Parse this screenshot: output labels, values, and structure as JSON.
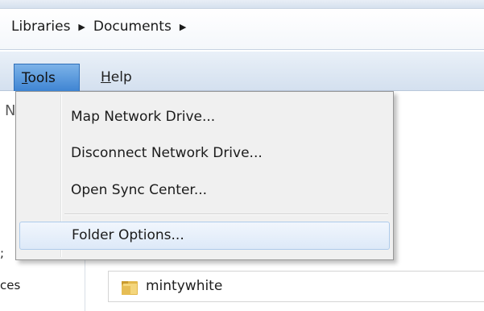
{
  "address": {
    "crumbs": [
      "Libraries",
      "Documents"
    ],
    "separator": "▶"
  },
  "menubar": {
    "tools_first": "T",
    "tools_rest": "ools",
    "help_first": "H",
    "help_rest": "elp"
  },
  "behind": {
    "toolbar_fragment": "N",
    "nav_fragment_1": ";",
    "nav_fragment_2": "ces"
  },
  "tools_menu": {
    "items": [
      {
        "label": "Map Network Drive..."
      },
      {
        "label": "Disconnect Network Drive..."
      },
      {
        "label": "Open Sync Center..."
      },
      {
        "label": "Folder Options...",
        "highlighted": true
      }
    ]
  },
  "content": {
    "folder_name": "mintywhite",
    "folder_icon": "folder-icon"
  },
  "colors": {
    "menu_highlight": "#5d9de0",
    "item_hover_border": "#aecbeb",
    "menu_bg": "#f0f0f0"
  }
}
